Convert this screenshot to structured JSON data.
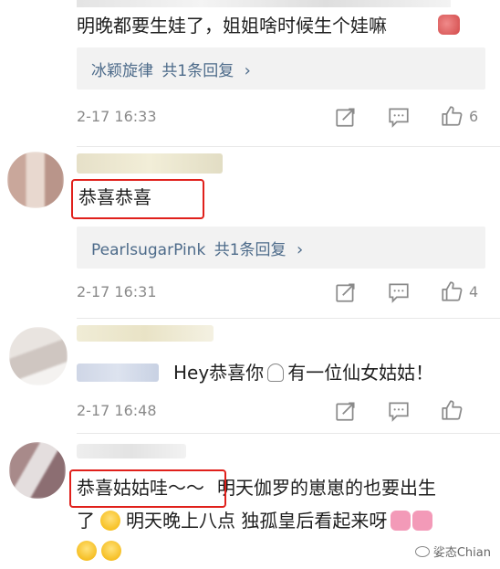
{
  "comments": [
    {
      "text_line": "明晚都要生娃了，姐姐啥时候生个娃嘛",
      "reply_user": "冰颖旋律",
      "reply_count": "共1条回复",
      "time": "2-17 16:33",
      "likes": "6"
    },
    {
      "text": "恭喜恭喜",
      "reply_user": "PearlsugarPink",
      "reply_count": "共1条回复",
      "time": "2-17 16:31",
      "likes": "4"
    },
    {
      "text_prefix": "Hey恭喜你",
      "text_suffix": "有一位仙女姑姑！",
      "time": "2-17 16:48"
    },
    {
      "text_highlight": "恭喜姑姑哇～～",
      "text_line1_rest": "明天伽罗的崽崽的也要出生",
      "text_line2_start": "了",
      "text_line2_rest": "明天晚上八点 独孤皇后看起来呀"
    }
  ],
  "reply_chevron": "›",
  "watermark": "娑态Chian",
  "colors": {
    "highlight_box": "#e0201b",
    "link": "#4d6b8a",
    "meta": "#8a8a8a"
  }
}
